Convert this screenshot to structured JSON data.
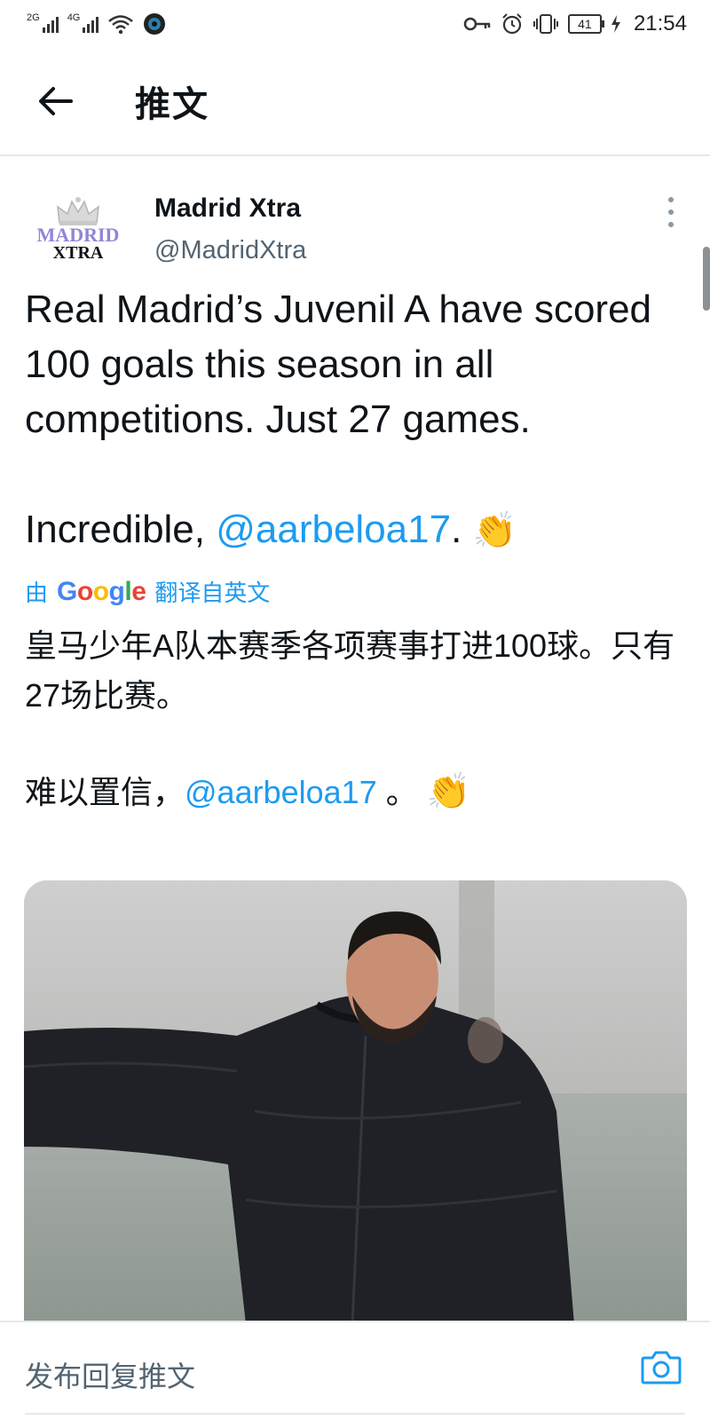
{
  "status_bar": {
    "net1": "2G",
    "net2": "4G",
    "battery": "41",
    "time": "21:54"
  },
  "header": {
    "title": "推文"
  },
  "tweet": {
    "author_name": "Madrid Xtra",
    "author_handle": "@MadridXtra",
    "avatar_line1": "MADRID",
    "avatar_line2": "XTRA",
    "text_part1": "Real Madrid’s Juvenil A have scored 100 goals this season in all competitions. Just 27 games.\n\nIncredible, ",
    "text_mention": "@aarbeloa17",
    "text_part2": ". ",
    "text_emoji": "👏",
    "translate_prefix": "由",
    "translate_suffix": "翻译自英文",
    "translated_line1": "皇马少年A队本赛季各项赛事打进100球。只有27场比赛。",
    "translated_line2_prefix": "难以置信，",
    "translated_line2_mention": "@aarbeloa17",
    "translated_line2_suffix": " 。",
    "translated_emoji": "👏"
  },
  "reply_bar": {
    "placeholder": "发布回复推文"
  },
  "icons": {
    "back": "arrow-left-icon",
    "more": "more-vertical-icon",
    "camera": "camera-icon"
  },
  "colors": {
    "link": "#1d9bf0",
    "text": "#0f1419",
    "secondary": "#536471",
    "divider": "#e6e9eb"
  }
}
